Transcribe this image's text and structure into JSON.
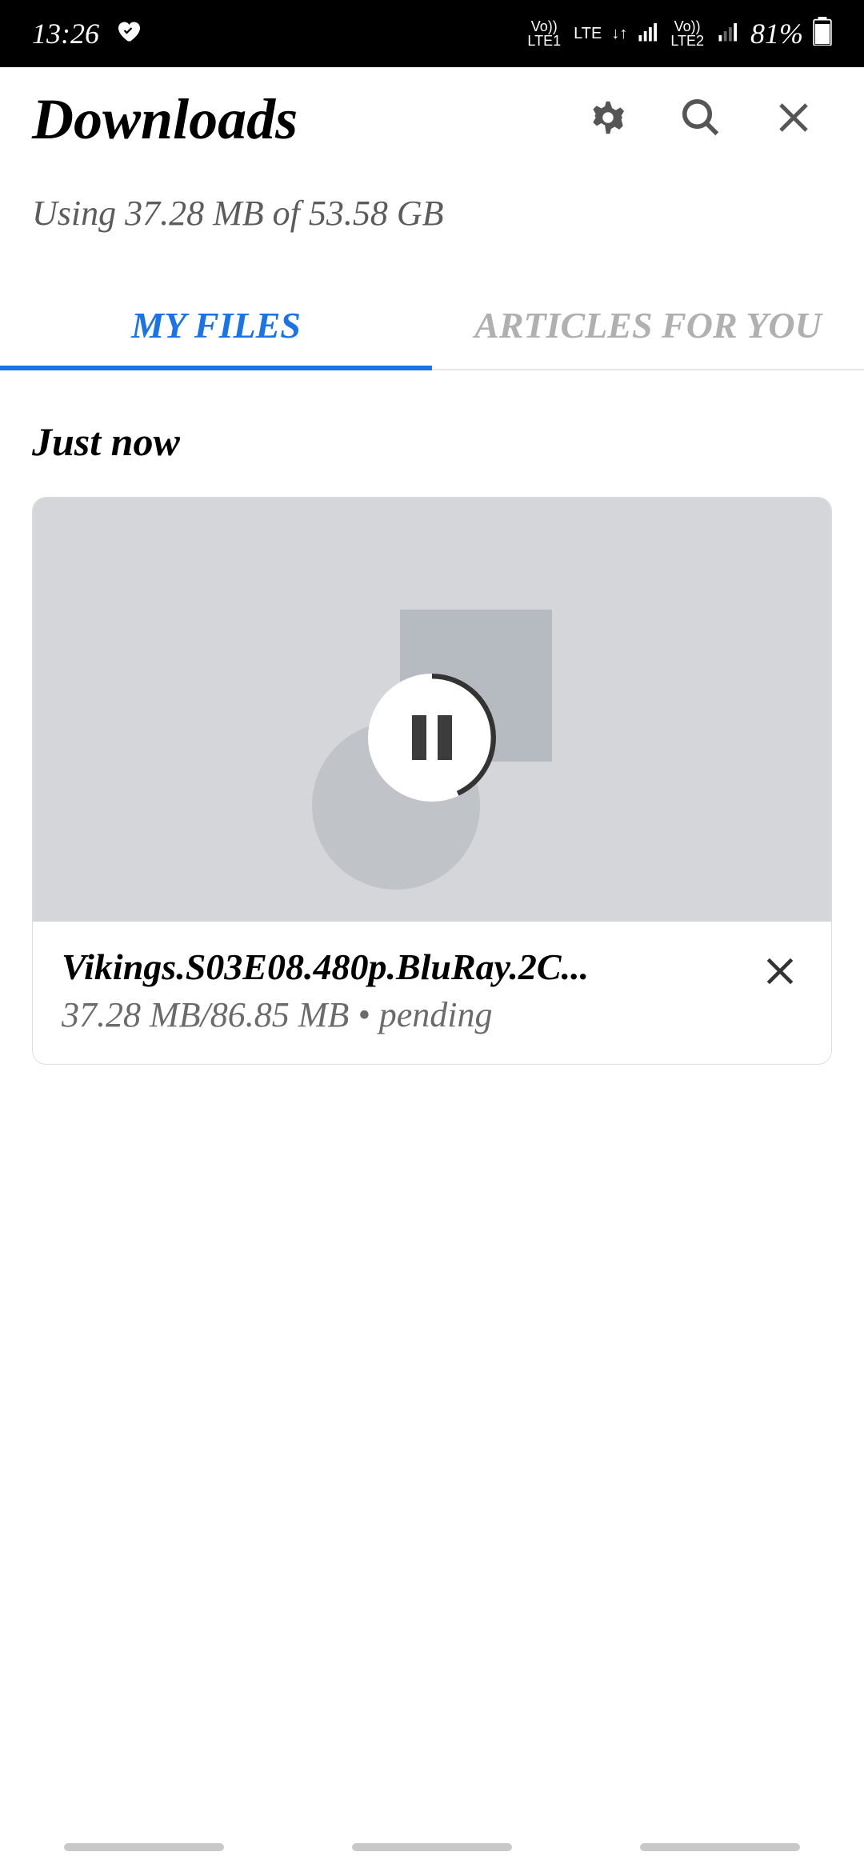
{
  "status_bar": {
    "time": "13:26",
    "lte1_label": "LTE1",
    "lte2_label": "LTE2",
    "vo_label": "Vo))",
    "lte_label": "LTE",
    "battery": "81%"
  },
  "header": {
    "title": "Downloads",
    "storage_usage": "Using 37.28 MB of 53.58 GB"
  },
  "tabs": {
    "my_files": "MY FILES",
    "articles": "ARTICLES FOR YOU"
  },
  "sections": [
    {
      "label": "Just now",
      "items": [
        {
          "filename": "Vikings.S03E08.480p.BluRay.2C...",
          "status_line": "37.28 MB/86.85 MB • pending",
          "downloaded_mb": 37.28,
          "total_mb": 86.85,
          "state": "pending"
        }
      ]
    }
  ]
}
